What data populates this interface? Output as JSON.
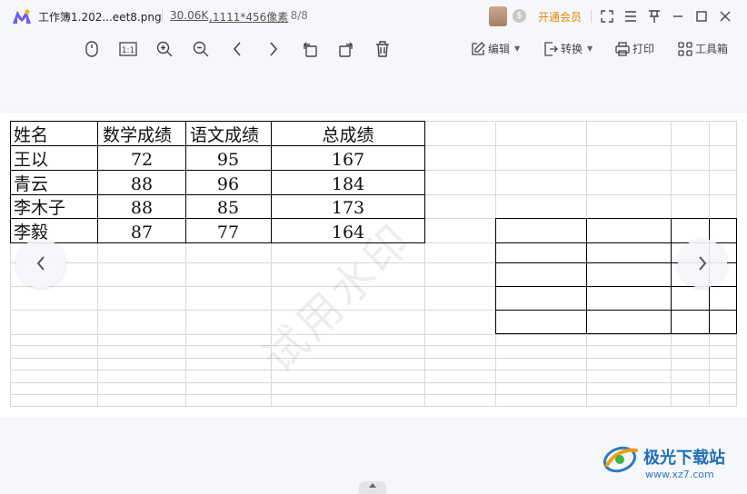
{
  "titlebar": {
    "file_name": "工作簿1.202...eet8.png",
    "file_size": "30.06K",
    "dimensions": ",1111*456像素",
    "page": ", 8/8",
    "vip_label": "开通会员"
  },
  "toolbar": {
    "fit_label": "1:1",
    "edit_label": "编辑",
    "convert_label": "转换",
    "print_label": "打印",
    "tools_label": "工具箱"
  },
  "table": {
    "headers": [
      "姓名",
      "数学成绩",
      "语文成绩",
      "总成绩"
    ],
    "rows": [
      [
        "王以",
        "72",
        "95",
        "167"
      ],
      [
        "青云",
        "88",
        "96",
        "184"
      ],
      [
        "李木子",
        "88",
        "85",
        "173"
      ],
      [
        "李毅",
        "87",
        "77",
        "164"
      ]
    ]
  },
  "watermark": "试用水印",
  "brand": {
    "name": "极光下载站",
    "url": "www.xz7.com"
  },
  "colors": {
    "accent": "#e08a00",
    "brand": "#1f6fb8",
    "grid": "#d0d4dc"
  }
}
